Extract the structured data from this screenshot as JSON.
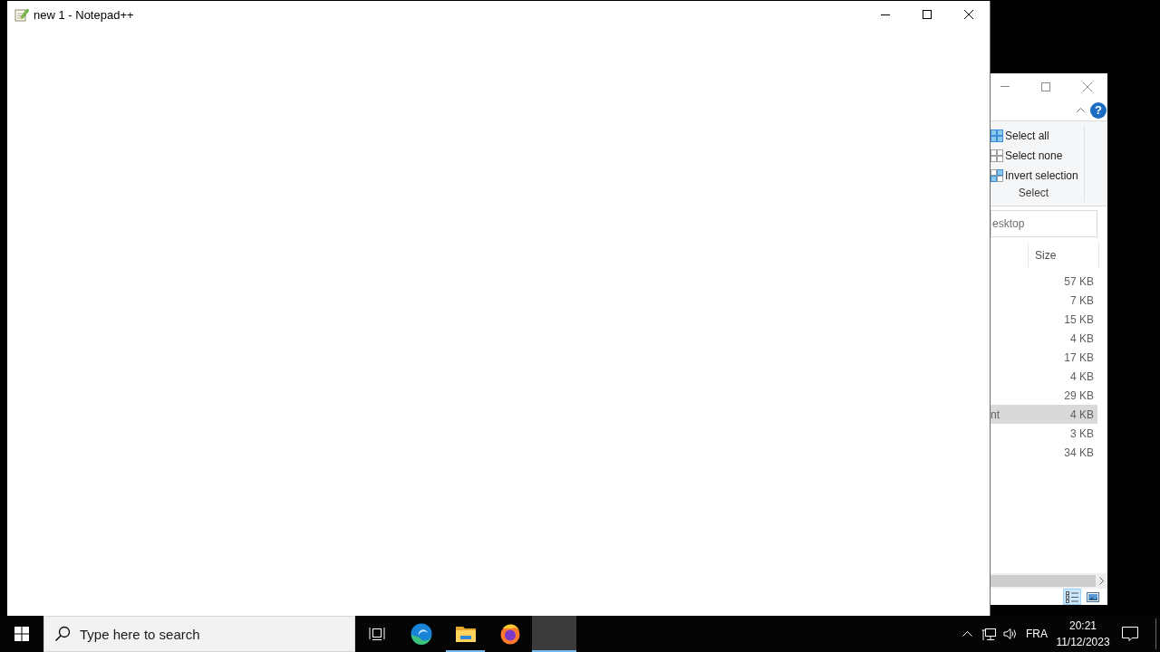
{
  "notepad_window": {
    "title": "new 1 - Notepad++"
  },
  "explorer_window": {
    "ribbon": {
      "help_label": "?",
      "commands": [
        {
          "kind": "all",
          "label": "Select all"
        },
        {
          "kind": "none",
          "label": "Select none"
        },
        {
          "kind": "invert",
          "label": "Invert selection"
        }
      ],
      "group_label": "Select"
    },
    "search": {
      "placeholder": "esktop"
    },
    "columns": [
      "Size"
    ],
    "rows": [
      {
        "size": "57 KB",
        "selected": false
      },
      {
        "size": "7 KB",
        "selected": false
      },
      {
        "size": "15 KB",
        "selected": false
      },
      {
        "size": "4 KB",
        "selected": false
      },
      {
        "size": "17 KB",
        "selected": false
      },
      {
        "size": "4 KB",
        "selected": false
      },
      {
        "size": "29 KB",
        "selected": false
      },
      {
        "column_1": "nt",
        "size": "4 KB",
        "selected": true
      },
      {
        "size": "3 KB",
        "selected": false
      },
      {
        "size": "34 KB",
        "selected": false
      }
    ],
    "view_buttons": [
      {
        "kind": "details",
        "selected": true
      },
      {
        "kind": "tiles",
        "selected": false
      }
    ]
  },
  "taskbar": {
    "search": {
      "placeholder": "Type here to search"
    },
    "apps": [
      {
        "kind": "swirl",
        "running": false,
        "selected": false
      },
      {
        "kind": "folder",
        "running": true,
        "selected": false
      },
      {
        "kind": "flame",
        "running": false,
        "selected": false
      },
      {
        "kind": "blank",
        "running": true,
        "selected": true
      }
    ],
    "tray": {
      "language": "FRA",
      "time": "20:21",
      "date": "11/12/2023"
    }
  }
}
